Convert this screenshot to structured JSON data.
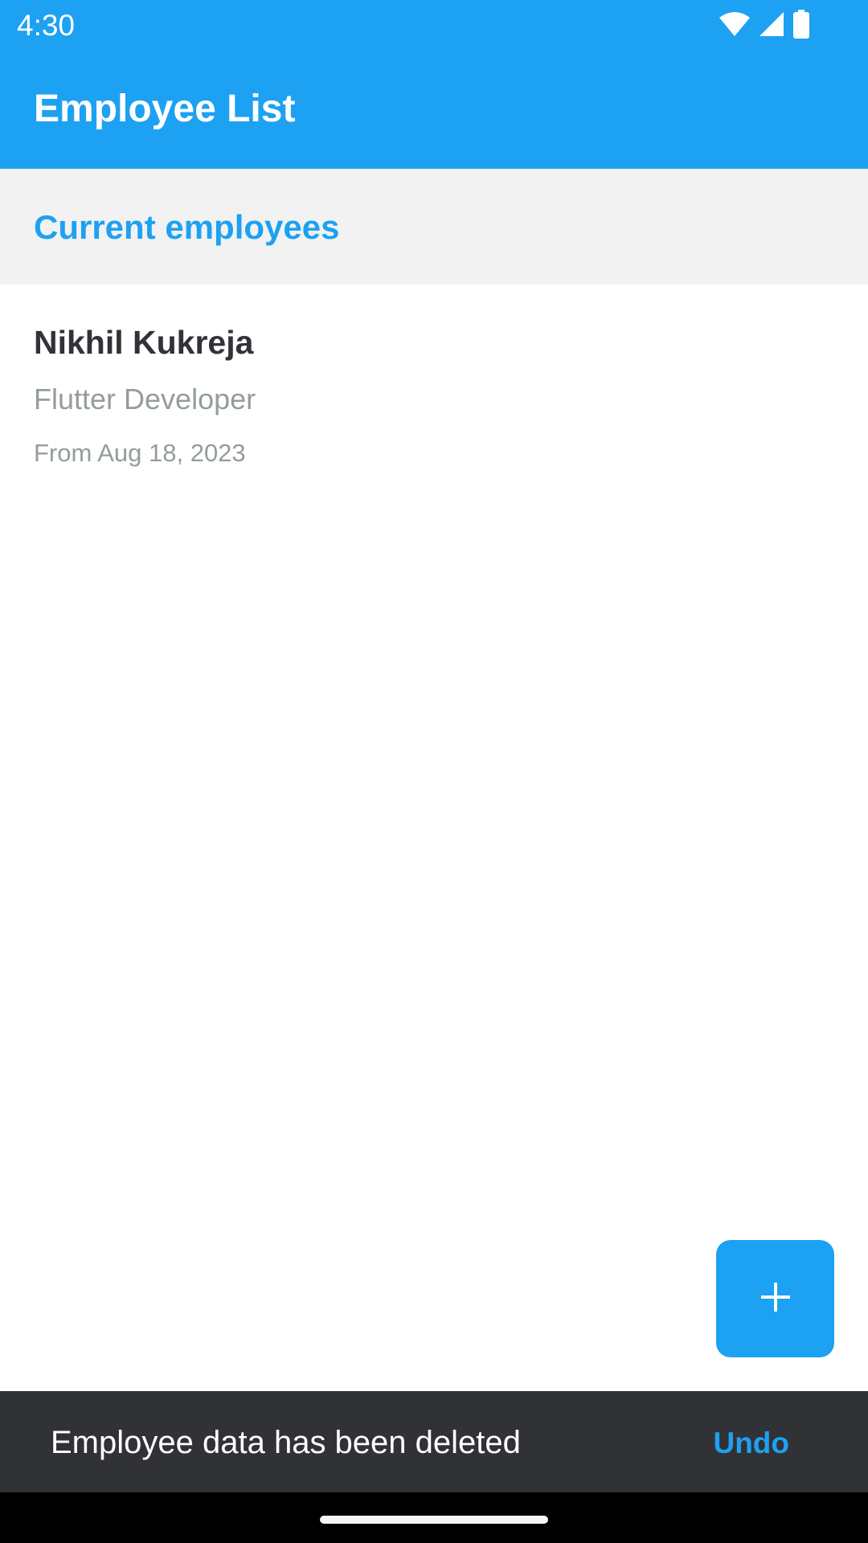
{
  "status_bar": {
    "time": "4:30",
    "icons": [
      "wifi-icon",
      "signal-icon",
      "battery-icon"
    ]
  },
  "app_bar": {
    "title": "Employee List"
  },
  "section": {
    "title": "Current employees"
  },
  "employees": [
    {
      "name": "Nikhil Kukreja",
      "role": "Flutter Developer",
      "date": "From Aug 18, 2023"
    }
  ],
  "fab": {
    "icon": "plus-icon"
  },
  "snackbar": {
    "message": "Employee data has been deleted",
    "action": "Undo"
  },
  "colors": {
    "primary": "#1da1f2",
    "section_bg": "#f2f2f2",
    "snackbar_bg": "#313235",
    "text_primary": "#323238",
    "text_secondary": "#949c9e"
  }
}
